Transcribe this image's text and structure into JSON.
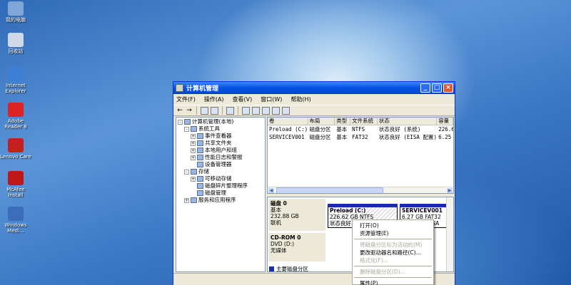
{
  "desktop": {
    "icons": [
      {
        "label": "我的电脑",
        "color": "#7ea7d8"
      },
      {
        "label": "回收站",
        "color": "#cfd8e6"
      },
      {
        "label": "Internet Explorer",
        "color": "#3c7fd6"
      },
      {
        "label": "Adobe Reader 8",
        "color": "#d22"
      },
      {
        "label": "Lenovo Care",
        "color": "#c42020"
      },
      {
        "label": "McAfee Install",
        "color": "#c01818"
      },
      {
        "label": "Windows Medi...",
        "color": "#3b6dbc"
      }
    ]
  },
  "window": {
    "title": "计算机管理",
    "controls": {
      "minimize": "_",
      "maximize": "□",
      "close": "×"
    },
    "menu": [
      "文件(F)",
      "操作(A)",
      "查看(V)",
      "窗口(W)",
      "帮助(H)"
    ],
    "tree": [
      {
        "label": "计算机管理(本地)",
        "level": 0,
        "toggle": "-"
      },
      {
        "label": "系统工具",
        "level": 1,
        "toggle": "-"
      },
      {
        "label": "事件查看器",
        "level": 2,
        "toggle": "+"
      },
      {
        "label": "共享文件夹",
        "level": 2,
        "toggle": "+"
      },
      {
        "label": "本地用户和组",
        "level": 2,
        "toggle": "+"
      },
      {
        "label": "性能日志和警报",
        "level": 2,
        "toggle": "+"
      },
      {
        "label": "设备管理器",
        "level": 2,
        "toggle": ""
      },
      {
        "label": "存储",
        "level": 1,
        "toggle": "-"
      },
      {
        "label": "可移动存储",
        "level": 2,
        "toggle": "+"
      },
      {
        "label": "磁盘碎片整理程序",
        "level": 2,
        "toggle": ""
      },
      {
        "label": "磁盘管理",
        "level": 2,
        "toggle": ""
      },
      {
        "label": "服务和应用程序",
        "level": 1,
        "toggle": "+"
      }
    ],
    "volumes": {
      "headers": [
        "卷",
        "布局",
        "类型",
        "文件系统",
        "状态",
        "容量"
      ],
      "rows": [
        [
          "Preload (C:)",
          "磁盘分区",
          "基本",
          "NTFS",
          "状态良好 (系统)",
          "226.62"
        ],
        [
          "SERVICEV001",
          "磁盘分区",
          "基本",
          "FAT32",
          "状态良好 (EISA 配置)",
          "6.25 G"
        ]
      ]
    },
    "disks": [
      {
        "name": "磁盘 0",
        "type": "基本",
        "size": "232.88 GB",
        "status": "联机"
      },
      {
        "name": "CD-ROM 0",
        "type": "DVD (D:)",
        "size": "",
        "status": "无媒体"
      }
    ],
    "partitions": [
      {
        "name": "Preload  (C:)",
        "size": "226.62 GB NTFS",
        "status": "状态良好 (系统)"
      },
      {
        "name": "SERVICEV001",
        "size": "6.27 GB FAT32",
        "status": "状态良好 (EISA"
      }
    ],
    "legend": "主要磁盘分区"
  },
  "context_menu": [
    {
      "label": "打开(O)",
      "enabled": true
    },
    {
      "label": "资源管理(E)",
      "enabled": true
    },
    {
      "sep": true
    },
    {
      "label": "将磁盘分区标为活动的(M)",
      "enabled": false
    },
    {
      "label": "更改驱动器名和路径(C)...",
      "enabled": true
    },
    {
      "label": "格式化(F)...",
      "enabled": false
    },
    {
      "sep": true
    },
    {
      "label": "删除磁盘分区(D)...",
      "enabled": false
    },
    {
      "sep": true
    },
    {
      "label": "属性(P)",
      "enabled": true
    }
  ],
  "colors": {
    "titlebar": "#0a54e3",
    "partition_bar": "#1b2bb0",
    "window_bg": "#ece9d8"
  }
}
